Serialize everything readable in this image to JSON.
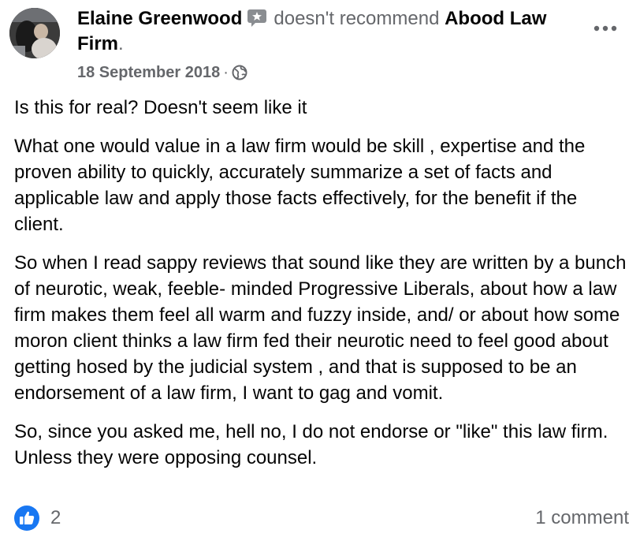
{
  "post": {
    "author": "Elaine Greenwood",
    "verb": "doesn't recommend",
    "page_name": "Abood Law Firm",
    "page_suffix": ".",
    "date": "18 September 2018",
    "date_separator": "·",
    "audience_icon": "globe-icon",
    "badge_icon": "star-badge-icon",
    "more_icon": "more-options-icon",
    "paragraphs": [
      "Is this for real? Doesn't seem like it",
      "What one would value in a law firm would be skill , expertise and the proven ability to quickly, accurately summarize a set of facts and applicable law and apply those facts effectively, for the benefit if the client.",
      "So when I read sappy  reviews that sound like they  are  written by a bunch of neurotic, weak, feeble- minded Progressive Liberals, about how a law firm  makes them feel all warm and fuzzy inside, and/ or about  how some moron client thinks a law firm fed their neurotic need to feel good about getting hosed by the judicial system , and that is supposed to be an endorsement of a law firm, I want to gag and vomit.",
      "So, since you asked me, hell no,  I do not endorse or \"like\" this law firm.  Unless they were opposing counsel."
    ]
  },
  "footer": {
    "reaction_icon": "like-icon",
    "reaction_count": "2",
    "comments_label": "1 comment"
  },
  "colors": {
    "primary_text": "#050505",
    "secondary_text": "#65676b",
    "like_blue": "#1877f2"
  }
}
